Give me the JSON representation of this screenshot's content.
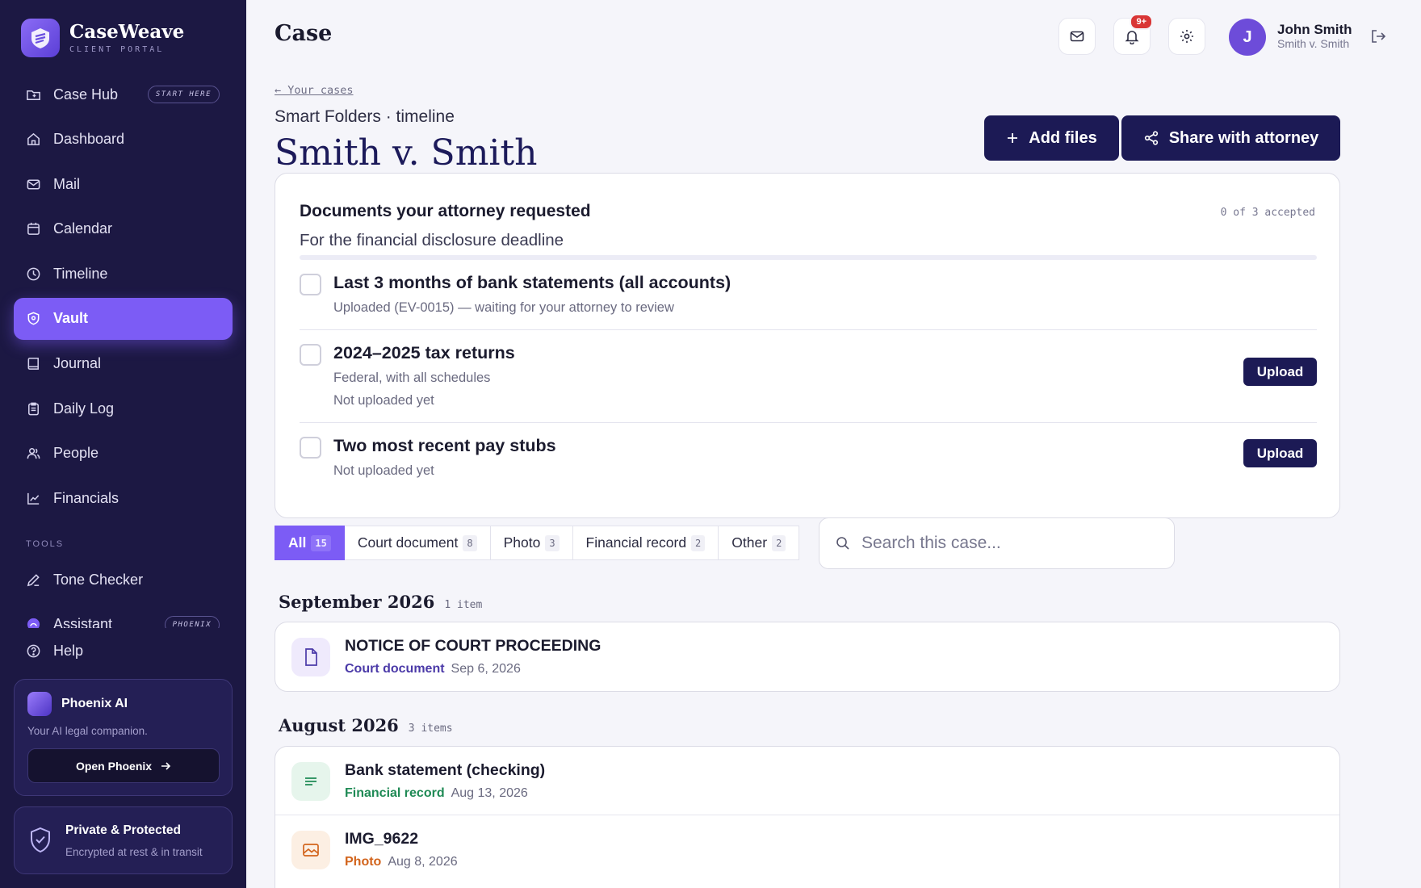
{
  "brand": {
    "name": "CaseWeave",
    "sub": "CLIENT PORTAL"
  },
  "nav": [
    {
      "label": "Case Hub",
      "icon": "folder-icon",
      "badge": "START HERE"
    },
    {
      "label": "Dashboard",
      "icon": "home-icon"
    },
    {
      "label": "Mail",
      "icon": "mail-icon"
    },
    {
      "label": "Calendar",
      "icon": "calendar-icon"
    },
    {
      "label": "Timeline",
      "icon": "clock-icon"
    },
    {
      "label": "Vault",
      "icon": "shield-icon",
      "active": true
    },
    {
      "label": "Journal",
      "icon": "book-icon"
    },
    {
      "label": "Daily Log",
      "icon": "clipboard-icon"
    },
    {
      "label": "People",
      "icon": "users-icon"
    },
    {
      "label": "Financials",
      "icon": "chart-icon"
    }
  ],
  "tools": {
    "label": "TOOLS",
    "tone_checker": "Tone Checker",
    "assistant": "Assistant",
    "assistant_badge": "PHOENIX",
    "help": "Help"
  },
  "phoenix": {
    "title": "Phoenix AI",
    "subtitle": "Your AI legal companion.",
    "button": "Open Phoenix"
  },
  "privacy": {
    "title": "Private & Protected",
    "subtitle": "Encrypted at rest & in transit"
  },
  "header": {
    "page_label": "Case",
    "notifications_badge": "9+",
    "avatar_initial": "J",
    "user_name": "John Smith",
    "user_case": "Smith v. Smith"
  },
  "case": {
    "back_link": "← Your cases",
    "folder_line": "Smart Folders · timeline",
    "title": "Smith v. Smith",
    "add_files": "Add files",
    "share": "Share with attorney"
  },
  "requested": {
    "title": "Documents your attorney requested",
    "subtitle": "For the financial disclosure deadline",
    "count": "0 of 3 accepted",
    "progress_fraction": 0,
    "items": [
      {
        "title": "Last 3 months of bank statements (all accounts)",
        "lines": [
          "Uploaded (EV-0015) — waiting for your attorney to review"
        ],
        "button": ""
      },
      {
        "title": "2024–2025 tax returns",
        "lines": [
          "Federal, with all schedules",
          "Not uploaded yet"
        ],
        "button": "Upload"
      },
      {
        "title": "Two most recent pay stubs",
        "lines": [
          "Not uploaded yet"
        ],
        "button": "Upload"
      }
    ]
  },
  "filters": [
    {
      "label": "All",
      "count": "15",
      "active": true
    },
    {
      "label": "Court document",
      "count": "8"
    },
    {
      "label": "Photo",
      "count": "3"
    },
    {
      "label": "Financial record",
      "count": "2"
    },
    {
      "label": "Other",
      "count": "2"
    }
  ],
  "search": {
    "placeholder": "Search this case..."
  },
  "colors": {
    "accent": "#7c5cf5",
    "sidebar": "#1c1843",
    "court": "#4b3aa8",
    "financial": "#1f8a55",
    "photo": "#d2641c"
  },
  "groups": [
    {
      "title": "September 2026",
      "count": "1 item",
      "docs": [
        {
          "title": "NOTICE OF COURT PROCEEDING",
          "category": "Court document",
          "date": "Sep 6, 2026",
          "icon": "document-icon",
          "kind": "court"
        }
      ]
    },
    {
      "title": "August 2026",
      "count": "3 items",
      "docs": [
        {
          "title": "Bank statement (checking)",
          "category": "Financial record",
          "date": "Aug 13, 2026",
          "icon": "lines-icon",
          "kind": "financial"
        },
        {
          "title": "IMG_9622",
          "category": "Photo",
          "date": "Aug 8, 2026",
          "icon": "image-icon",
          "kind": "photo"
        }
      ]
    }
  ]
}
